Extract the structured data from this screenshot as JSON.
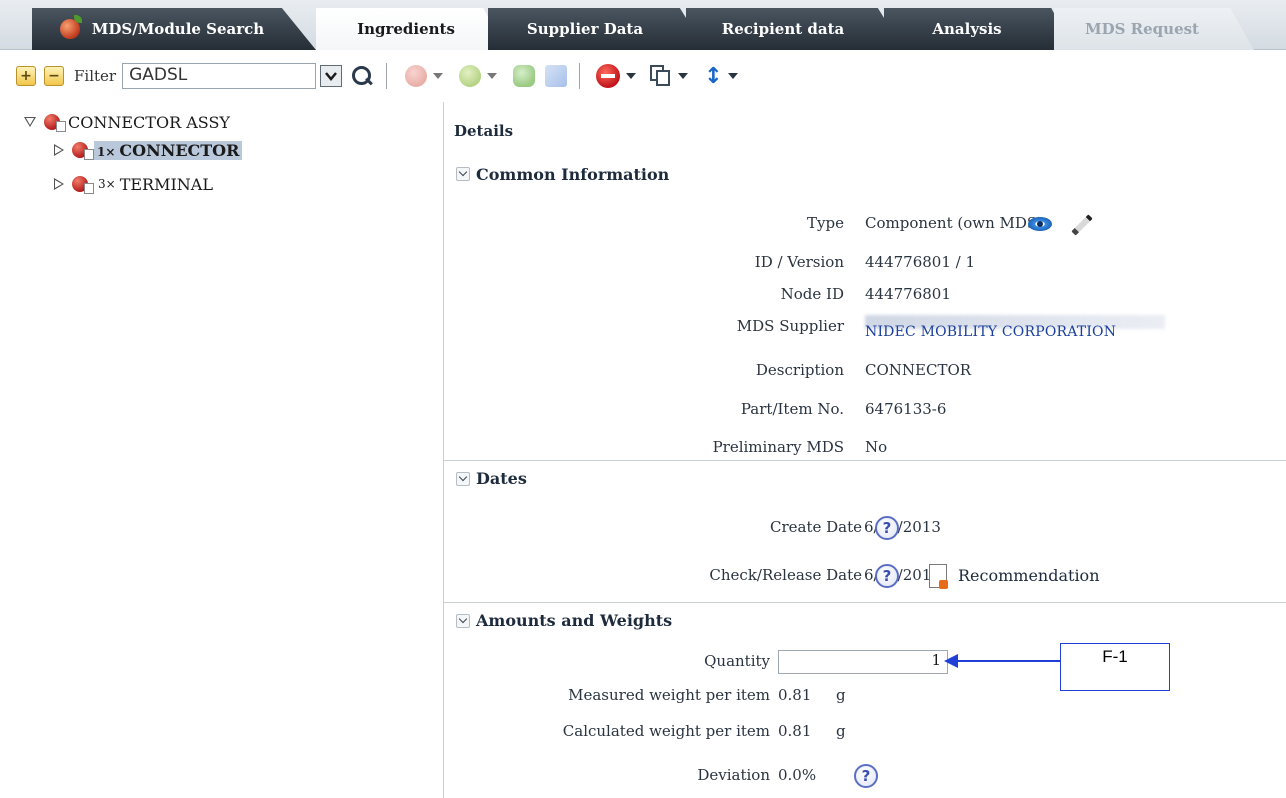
{
  "tabs": [
    {
      "label": "MDS/Module Search",
      "state": "normal"
    },
    {
      "label": "Ingredients",
      "state": "active"
    },
    {
      "label": "Supplier Data",
      "state": "normal"
    },
    {
      "label": "Recipient data",
      "state": "normal"
    },
    {
      "label": "Analysis",
      "state": "normal"
    },
    {
      "label": "MDS Request",
      "state": "disabled"
    }
  ],
  "toolbar": {
    "expand_icon": "plus-square-icon",
    "collapse_icon": "minus-square-icon",
    "filter_label": "Filter",
    "filter_value": "GADSL"
  },
  "tree": {
    "root": {
      "label": "CONNECTOR ASSY",
      "expanded": true
    },
    "children": [
      {
        "position": "1×",
        "label": "CONNECTOR",
        "selected": true
      },
      {
        "position": "3×",
        "label": "TERMINAL",
        "selected": false
      }
    ]
  },
  "details": {
    "title": "Details",
    "common": {
      "heading": "Common Information",
      "type_label": "Type",
      "type_value": "Component (own MDS)",
      "id_label": "ID / Version",
      "id_value": "444776801 / 1",
      "node_label": "Node ID",
      "node_value": "444776801",
      "supplier_label": "MDS Supplier",
      "supplier_value": "NIDEC MOBILITY CORPORATION",
      "desc_label": "Description",
      "desc_value": "CONNECTOR",
      "part_label": "Part/Item No.",
      "part_value": "6476133-6",
      "prelim_label": "Preliminary MDS",
      "prelim_value": "No"
    },
    "dates": {
      "heading": "Dates",
      "create_label": "Create Date",
      "create_value": "6/24/2013",
      "check_label": "Check/Release Date",
      "check_value": "6/24/2013",
      "recommendation_label": "Recommendation"
    },
    "amounts": {
      "heading": "Amounts and Weights",
      "quantity_label": "Quantity",
      "quantity_value": "1",
      "measured_label": "Measured weight per item",
      "measured_value": "0.81",
      "measured_unit": "g",
      "calculated_label": "Calculated weight per item",
      "calculated_value": "0.81",
      "calculated_unit": "g",
      "deviation_label": "Deviation",
      "deviation_value": "0.0%"
    }
  },
  "annotation": {
    "label": "F-1",
    "color": "#1f3fd6"
  },
  "colors": {
    "active_tab": "#ffffff",
    "dark_tab": "#2b333c",
    "link_blue": "#1a3f9c"
  }
}
